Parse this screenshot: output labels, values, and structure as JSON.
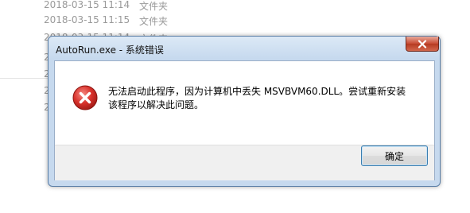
{
  "background_list": {
    "rows": [
      {
        "date": "2018-03-15 11:14",
        "type": "文件夹"
      },
      {
        "date": "2018-03-15 11:15",
        "type": "文件夹"
      },
      {
        "date": "2018-03-15 11:14",
        "type": "文件夹"
      },
      {
        "date": "2",
        "type": ""
      },
      {
        "date": "2",
        "type": ""
      },
      {
        "date": "2",
        "type": ""
      },
      {
        "date": "2",
        "type": ""
      }
    ]
  },
  "dialog": {
    "title": "AutoRun.exe - 系统错误",
    "icon": "error-icon",
    "message_line1": "无法启动此程序，因为计算机中丢失 MSVBVM60.DLL。尝试重新安装",
    "message_line2": "该程序以解决此问题。",
    "ok_label": "确定",
    "close_icon": "close-icon"
  },
  "colors": {
    "title_bar": "#c6d9ee",
    "close_button": "#c74a32",
    "error_red": "#d8312b"
  }
}
